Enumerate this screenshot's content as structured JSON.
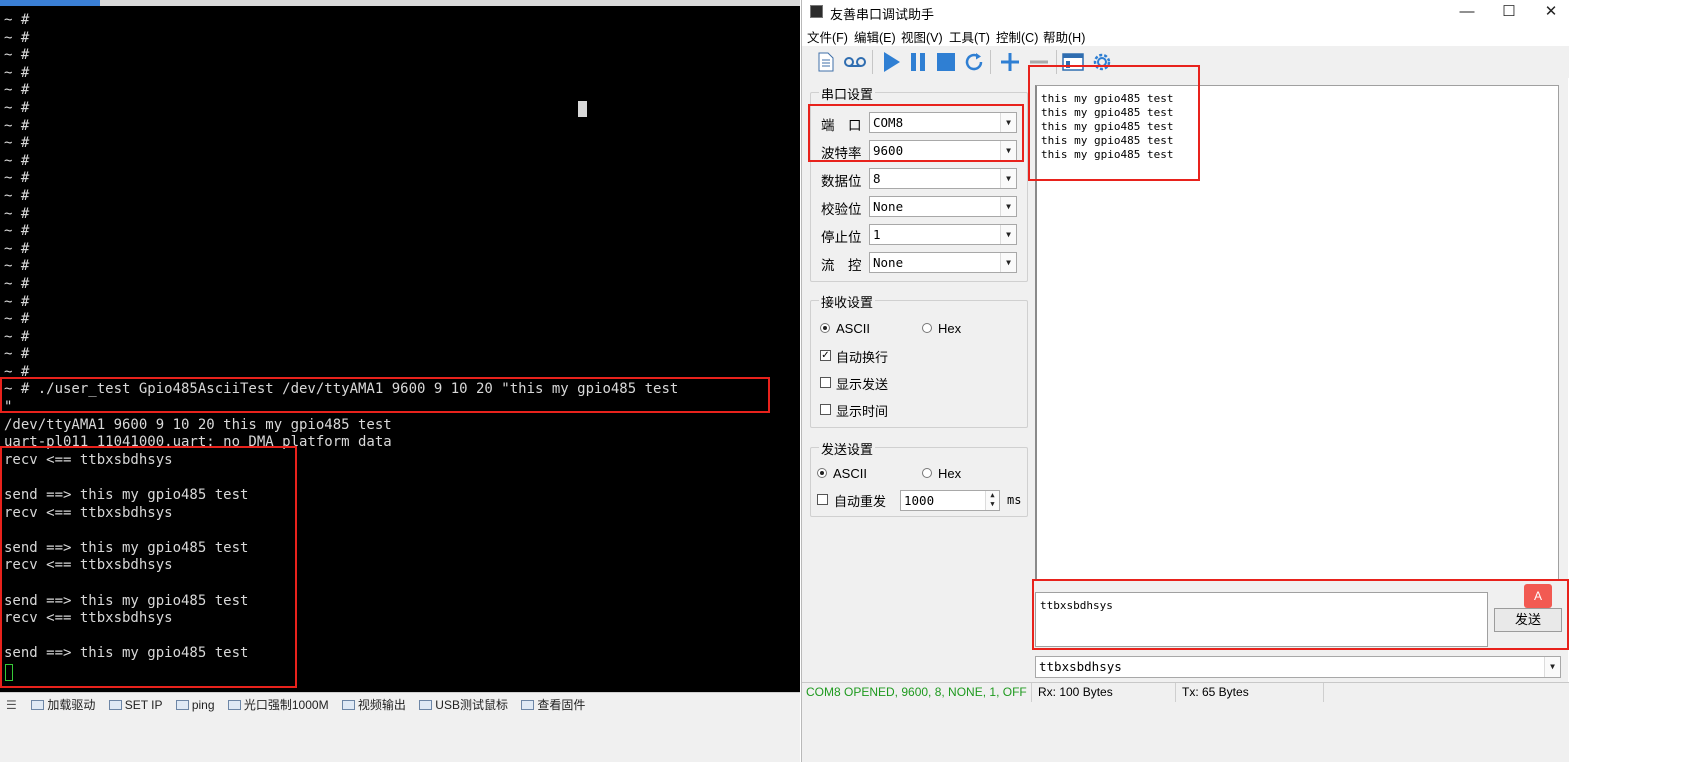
{
  "terminal": {
    "tab_label": "",
    "lines": [
      "~ #",
      "~ #",
      "~ #",
      "~ #",
      "~ #",
      "~ #",
      "~ #",
      "~ #",
      "~ #",
      "~ #",
      "~ #",
      "~ #",
      "~ #",
      "~ #",
      "~ #",
      "~ #",
      "~ #",
      "~ #",
      "~ #",
      "~ #",
      "~ #",
      "~ # ./user_test Gpio485AsciiTest /dev/ttyAMA1 9600 9 10 20 \"this my gpio485 test",
      "\"",
      "/dev/ttyAMA1 9600 9 10 20 this my gpio485 test",
      "uart-pl011 11041000.uart: no DMA platform data",
      "recv <== ttbxsbdhsys",
      "",
      "send ==> this my gpio485 test",
      "recv <== ttbxsbdhsys",
      "",
      "send ==> this my gpio485 test",
      "recv <== ttbxsbdhsys",
      "",
      "send ==> this my gpio485 test",
      "recv <== ttbxsbdhsys",
      "",
      "send ==> this my gpio485 test",
      ""
    ],
    "highlight_color": "#e8221c"
  },
  "taskbar": {
    "items": [
      "加载驱动",
      "SET IP",
      "ping",
      "光口强制1000M",
      "视频输出",
      "USB测试鼠标",
      "查看固件"
    ]
  },
  "app": {
    "title": "友善串口调试助手",
    "window_buttons": {
      "minimize": "—",
      "maximize": "☐",
      "close": "✕"
    },
    "menu": [
      "文件(F)",
      "编辑(E)",
      "视图(V)",
      "工具(T)",
      "控制(C)",
      "帮助(H)"
    ],
    "toolbar_icons": [
      "new-file-icon",
      "record-icon",
      "play-icon",
      "pause-icon",
      "stop-icon",
      "refresh-icon",
      "plus-icon",
      "minus-icon",
      "window-icon",
      "settings-gear-icon"
    ],
    "accent": "#2f7fd3",
    "serial_settings": {
      "title": "串口设置",
      "port_label": "端　口",
      "port": "COM8",
      "baud_label": "波特率",
      "baud": "9600",
      "databits_label": "数据位",
      "databits": "8",
      "parity_label": "校验位",
      "parity": "None",
      "stopbits_label": "停止位",
      "stopbits": "1",
      "flow_label": "流　控",
      "flow": "None"
    },
    "receive_settings": {
      "title": "接收设置",
      "ascii": "ASCII",
      "hex": "Hex",
      "auto_wrap": "自动换行",
      "show_send": "显示发送",
      "show_time": "显示时间"
    },
    "send_settings": {
      "title": "发送设置",
      "ascii": "ASCII",
      "hex": "Hex",
      "auto_resend": "自动重发",
      "interval": "1000",
      "unit": "ms"
    },
    "receive_text": "this my gpio485 test\nthis my gpio485 test\nthis my gpio485 test\nthis my gpio485 test\nthis my gpio485 test",
    "send_text": "ttbxsbdhsys",
    "send_button": "发送",
    "history_value": "ttbxsbdhsys",
    "status": {
      "connection": "COM8 OPENED, 9600, 8, NONE, 1, OFF",
      "connection_color": "#1f9a1f",
      "rx": "Rx: 100 Bytes",
      "tx": "Tx: 65 Bytes"
    }
  }
}
